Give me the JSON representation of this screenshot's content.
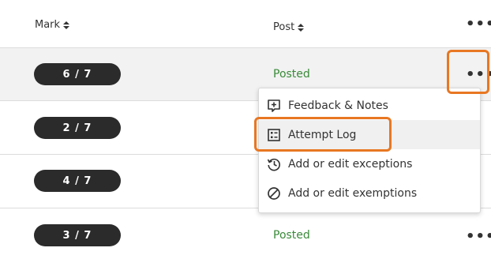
{
  "table": {
    "headers": {
      "mark": "Mark",
      "post": "Post"
    },
    "rows": [
      {
        "mark": "6 / 7",
        "post": "Posted"
      },
      {
        "mark": "2 / 7",
        "post": ""
      },
      {
        "mark": "4 / 7",
        "post": ""
      },
      {
        "mark": "3 / 7",
        "post": "Posted"
      }
    ]
  },
  "menu": {
    "items": [
      {
        "label": "Feedback & Notes",
        "icon": "feedback-plus-icon"
      },
      {
        "label": "Attempt Log",
        "icon": "attempt-log-icon"
      },
      {
        "label": "Add or edit exceptions",
        "icon": "clock-history-icon"
      },
      {
        "label": "Add or edit exemptions",
        "icon": "prohibited-icon"
      }
    ]
  },
  "colors": {
    "callout": "#e87722",
    "posted": "#3a8a3a",
    "pill": "#2b2b2b"
  }
}
